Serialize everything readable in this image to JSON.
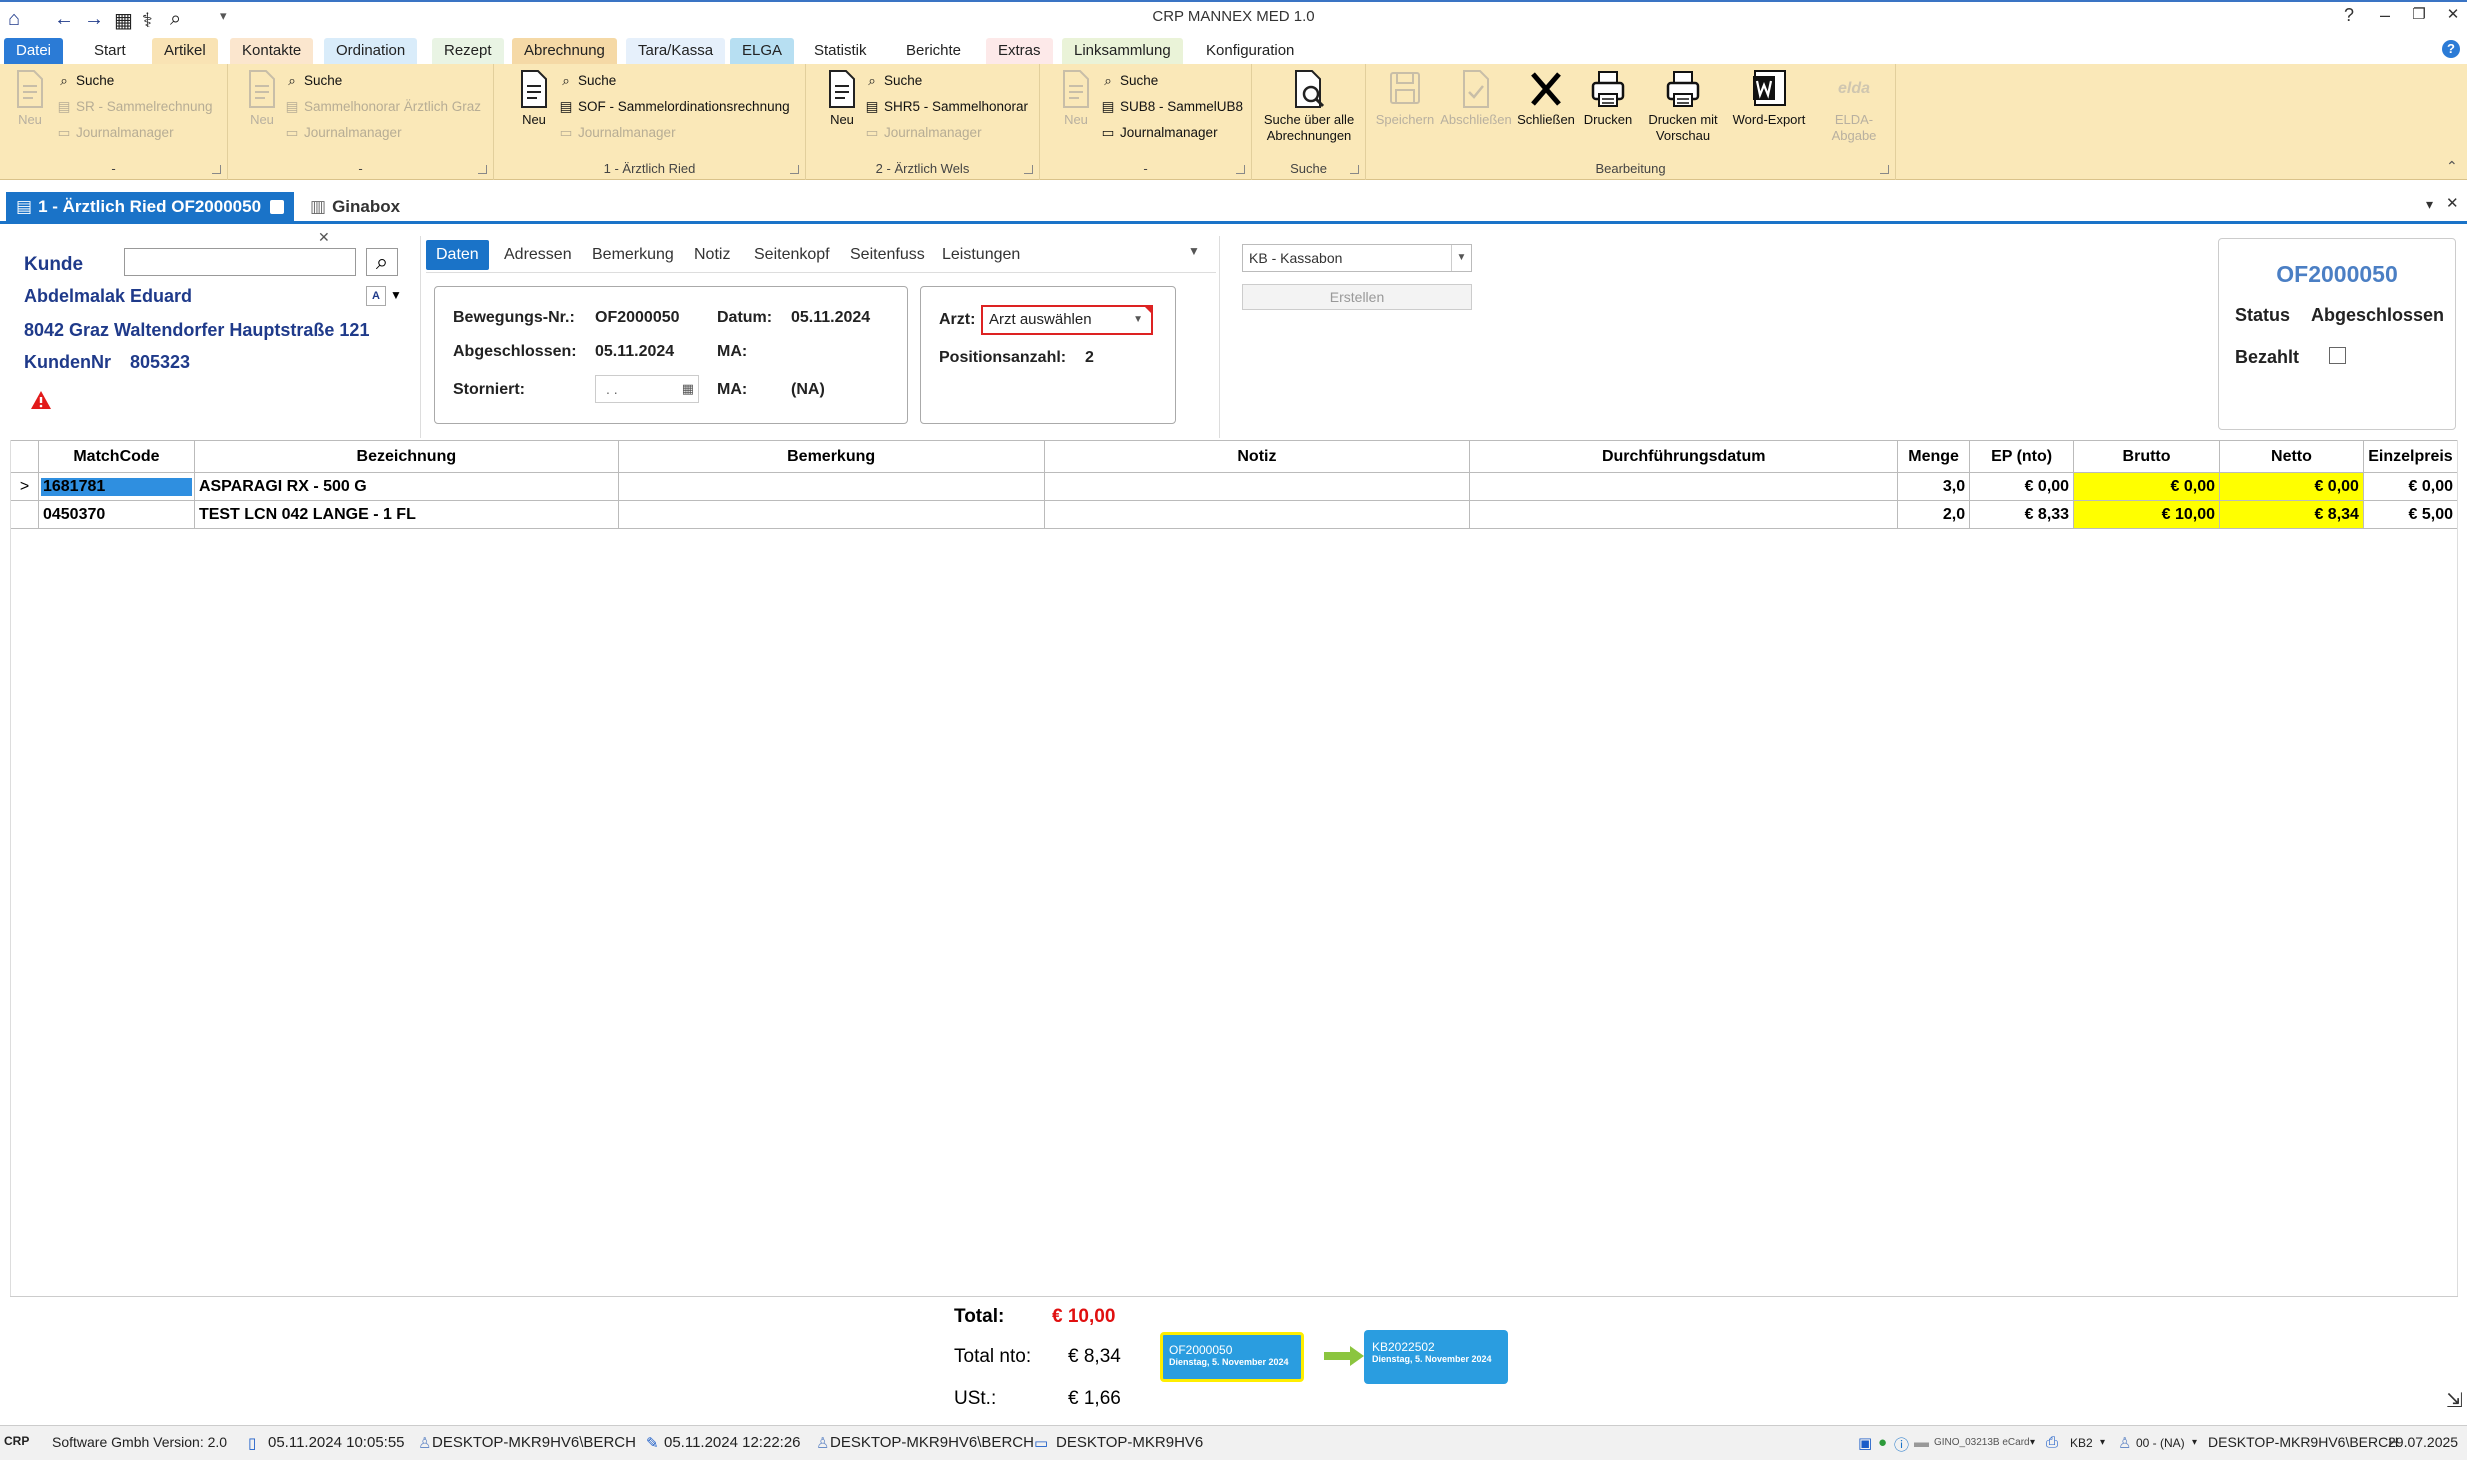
{
  "window": {
    "title": "CRP MANNEX MED 1.0",
    "help": "?",
    "minimize": "–",
    "restore": "❐",
    "close": "✕"
  },
  "menu": [
    {
      "label": "Datei",
      "bg": "#2b7bd6",
      "color": "#ffffff"
    },
    {
      "label": "Start",
      "bg": "",
      "color": "#222222"
    },
    {
      "label": "Artikel",
      "bg": "#f9e3b4",
      "color": "#222222"
    },
    {
      "label": "Kontakte",
      "bg": "#fbe6ce",
      "color": "#222222"
    },
    {
      "label": "Ordination",
      "bg": "#d9ecfa",
      "color": "#222222"
    },
    {
      "label": "Rezept",
      "bg": "#e9f4e4",
      "color": "#222222"
    },
    {
      "label": "Abrechnung",
      "bg": "#f5d9a6",
      "color": "#222222"
    },
    {
      "label": "Tara/Kassa",
      "bg": "#e6f0fb",
      "color": "#222222"
    },
    {
      "label": "ELGA",
      "bg": "#b7dff2",
      "color": "#222222"
    },
    {
      "label": "Statistik",
      "bg": "",
      "color": "#222222"
    },
    {
      "label": "Berichte",
      "bg": "",
      "color": "#222222"
    },
    {
      "label": "Extras",
      "bg": "#fde9e9",
      "color": "#222222"
    },
    {
      "label": "Linksammlung",
      "bg": "#eaf3d8",
      "color": "#222222"
    },
    {
      "label": "Konfiguration",
      "bg": "",
      "color": "#222222"
    }
  ],
  "ribbon": {
    "g1": {
      "neu": "Neu",
      "suche": "Suche",
      "item2": "SR - Sammelrechnung",
      "item3": "Journalmanager",
      "label": "-"
    },
    "g2": {
      "neu": "Neu",
      "suche": "Suche",
      "item2": "Sammelhonorar Ärztlich Graz",
      "item3": "Journalmanager",
      "label": "-"
    },
    "g3": {
      "neu": "Neu",
      "suche": "Suche",
      "item2": "SOF - Sammelordinationsrechnung",
      "item3": "Journalmanager",
      "label": "1 - Ärztlich Ried"
    },
    "g4": {
      "neu": "Neu",
      "suche": "Suche",
      "item2": "SHR5 - Sammelhonorar",
      "item3": "Journalmanager",
      "label": "2 - Ärztlich Wels"
    },
    "g5": {
      "neu": "Neu",
      "suche": "Suche",
      "item2": "SUB8 - SammelUB8",
      "item3": "Journalmanager",
      "label": "-"
    },
    "g6": {
      "btn_line1": "Suche über alle",
      "btn_line2": "Abrechnungen",
      "label": "Suche"
    },
    "g7": {
      "label": "Bearbeitung",
      "speichern": "Speichern",
      "abschliessen": "Abschließen",
      "schliessen": "Schließen",
      "drucken": "Drucken",
      "drucken_vorschau_1": "Drucken mit",
      "drucken_vorschau_2": "Vorschau",
      "word_export": "Word-Export",
      "elda_abgabe": "ELDA-Abgabe",
      "elda_logo": "elda"
    }
  },
  "doctabs": [
    {
      "label": "1 - Ärztlich Ried OF2000050"
    },
    {
      "label": "Ginabox"
    }
  ],
  "customer": {
    "kunde_label": "Kunde",
    "name": "Abdelmalak Eduard",
    "address": "8042 Graz Waltendorfer Hauptstraße 121",
    "kundennr_label": "KundenNr",
    "kundennr": "805323"
  },
  "datatabs": [
    "Daten",
    "Adressen",
    "Bemerkung",
    "Notiz",
    "Seitenkopf",
    "Seitenfuss",
    "Leistungen"
  ],
  "details": {
    "bewegungsnr_label": "Bewegungs-Nr.:",
    "bewegungsnr": "OF2000050",
    "datum_label": "Datum:",
    "datum": "05.11.2024",
    "abgeschlossen_label": "Abgeschlossen:",
    "abgeschlossen": "05.11.2024",
    "ma_label": "MA:",
    "storniert_label": "Storniert:",
    "storniert_value": ". .",
    "ma2_label": "MA:",
    "ma2_value": "(NA)",
    "arzt_label": "Arzt:",
    "arzt_value": "Arzt auswählen",
    "positionen_label": "Positionsanzahl:",
    "positionen": "2"
  },
  "doctype": {
    "selected": "KB - Kassabon",
    "erstellen": "Erstellen"
  },
  "statusbox": {
    "number": "OF2000050",
    "status_label": "Status",
    "status": "Abgeschlossen",
    "bezahlt_label": "Bezahlt"
  },
  "grid": {
    "columns": [
      "MatchCode",
      "Bezeichnung",
      "Bemerkung",
      "Notiz",
      "Durchführungsdatum",
      "Menge",
      "EP (nto)",
      "Brutto",
      "Netto",
      "Einzelpreis"
    ],
    "rows": [
      {
        "indicator": ">",
        "matchcode": "1681781",
        "bezeichnung": "ASPARAGI RX - 500 G",
        "bemerkung": "",
        "notiz": "",
        "datum": "",
        "menge": "3,0",
        "ep": "€ 0,00",
        "brutto": "€ 0,00",
        "netto": "€ 0,00",
        "einzelpreis": "€ 0,00"
      },
      {
        "indicator": "",
        "matchcode": "0450370",
        "bezeichnung": "TEST LCN 042 LANGE - 1 FL",
        "bemerkung": "",
        "notiz": "",
        "datum": "",
        "menge": "2,0",
        "ep": "€ 8,33",
        "brutto": "€ 10,00",
        "netto": "€ 8,34",
        "einzelpreis": "€ 5,00"
      }
    ]
  },
  "totals": {
    "total_label": "Total:",
    "total": "€ 10,00",
    "nto_label": "Total nto:",
    "nto": "€ 8,34",
    "ust_label": "USt.:",
    "ust": "€ 1,66"
  },
  "flow": {
    "from_number": "OF2000050",
    "from_date": "Dienstag, 5. November 2024",
    "to_number": "KB2022502",
    "to_date": "Dienstag, 5. November 2024"
  },
  "status": {
    "brand": "CRP",
    "company": "Software Gmbh Version: 2.0",
    "created": "05.11.2024 10:05:55",
    "created_by": "DESKTOP-MKR9HV6\\BERCH",
    "modified": "05.11.2024 12:22:26",
    "modified_by": "DESKTOP-MKR9HV6\\BERCH",
    "computer": "DESKTOP-MKR9HV6",
    "card": "GINO_03213B eCard",
    "kb": "KB2",
    "user_sel": "00 - (NA)",
    "user": "DESKTOP-MKR9HV6\\BERCH",
    "date": "29.07.2025"
  }
}
